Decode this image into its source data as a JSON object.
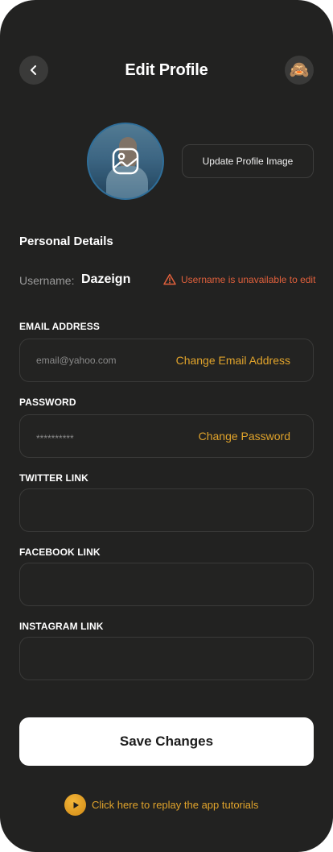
{
  "header": {
    "title": "Edit Profile",
    "back_icon": "chevron-left-icon",
    "avatar_emoji": "🙈"
  },
  "profile_image": {
    "overlay_icon": "image-icon",
    "update_label": "Update Profile Image"
  },
  "personal_details": {
    "title": "Personal Details",
    "username_label": "Username:",
    "username_value": "Dazeign",
    "username_warning": "Username is unavailable to edit",
    "warning_color": "#e0603c"
  },
  "fields": {
    "email": {
      "label": "EMAIL ADDRESS",
      "value": "email@yahoo.com",
      "action": "Change Email Address"
    },
    "password": {
      "label": "PASSWORD",
      "value": "**********",
      "action": "Change Password"
    },
    "twitter": {
      "label": "TWITTER LINK",
      "value": ""
    },
    "facebook": {
      "label": "FACEBOOK LINK",
      "value": ""
    },
    "instagram": {
      "label": "INSTAGRAM LINK",
      "value": ""
    }
  },
  "actions": {
    "save_label": "Save Changes",
    "tutorial_label": "Click here to replay the app tutorials",
    "accent_color": "#e0a32b"
  }
}
